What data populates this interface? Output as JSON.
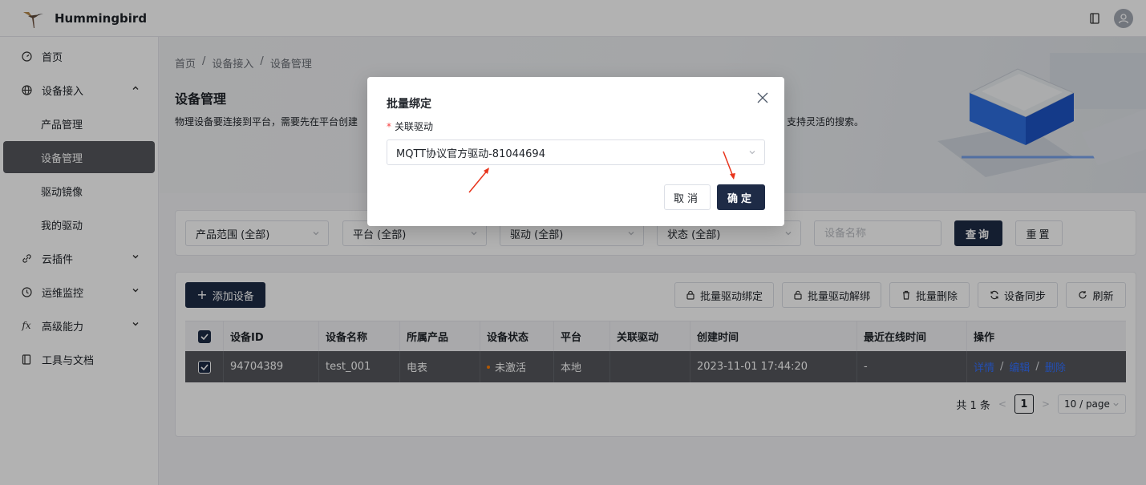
{
  "app": {
    "title": "Hummingbird"
  },
  "sidebar": {
    "items": [
      {
        "label": "首页"
      },
      {
        "label": "设备接入"
      },
      {
        "label": "产品管理"
      },
      {
        "label": "设备管理"
      },
      {
        "label": "驱动镜像"
      },
      {
        "label": "我的驱动"
      },
      {
        "label": "云插件"
      },
      {
        "label": "运维监控"
      },
      {
        "label": "高级能力"
      },
      {
        "label": "工具与文档"
      }
    ],
    "fx_glyph": "fx",
    "active_item": "设备管理"
  },
  "breadcrumb": [
    "首页",
    "设备接入",
    "设备管理"
  ],
  "breadcrumb_sep": "/",
  "page": {
    "title": "设备管理",
    "desc_left": "物理设备要连接到平台，需要先在平台创建",
    "desc_right": "支持灵活的搜索。"
  },
  "filters": {
    "product": "产品范围 (全部)",
    "platform": "平台 (全部)",
    "driver": "驱动 (全部)",
    "status": "状态 (全部)",
    "name_placeholder": "设备名称",
    "query_label": "查询",
    "reset_label": "重置"
  },
  "toolbar": {
    "add_label": "添加设备",
    "bind_label": "批量驱动绑定",
    "unbind_label": "批量驱动解绑",
    "delete_label": "批量删除",
    "sync_label": "设备同步",
    "refresh_label": "刷新"
  },
  "table": {
    "columns": [
      "设备ID",
      "设备名称",
      "所属产品",
      "设备状态",
      "平台",
      "关联驱动",
      "创建时间",
      "最近在线时间",
      "操作"
    ],
    "rows": [
      {
        "id": "94704389",
        "name": "test_001",
        "product": "电表",
        "status": "未激活",
        "platform": "本地",
        "driver": "",
        "created": "2023-11-01 17:44:20",
        "last_online": "-",
        "op_detail": "详情",
        "op_edit": "编辑",
        "op_delete": "删除"
      }
    ],
    "op_sep": "/"
  },
  "pagination": {
    "total": "共 1 条",
    "current": "1",
    "page_size": "10 / page",
    "prev": "<",
    "next": ">"
  },
  "modal": {
    "title": "批量绑定",
    "field_required_mark": "*",
    "field_label": "关联驱动",
    "selected_driver": "MQTT协议官方驱动-81044694",
    "cancel_label": "取消",
    "ok_label": "确定"
  },
  "colors": {
    "primary": "#1e2b46",
    "active_nav": "#55575c",
    "status_inactive": "#ff7d00",
    "link": "#3370ff",
    "annotation_arrow": "#e8341c"
  }
}
